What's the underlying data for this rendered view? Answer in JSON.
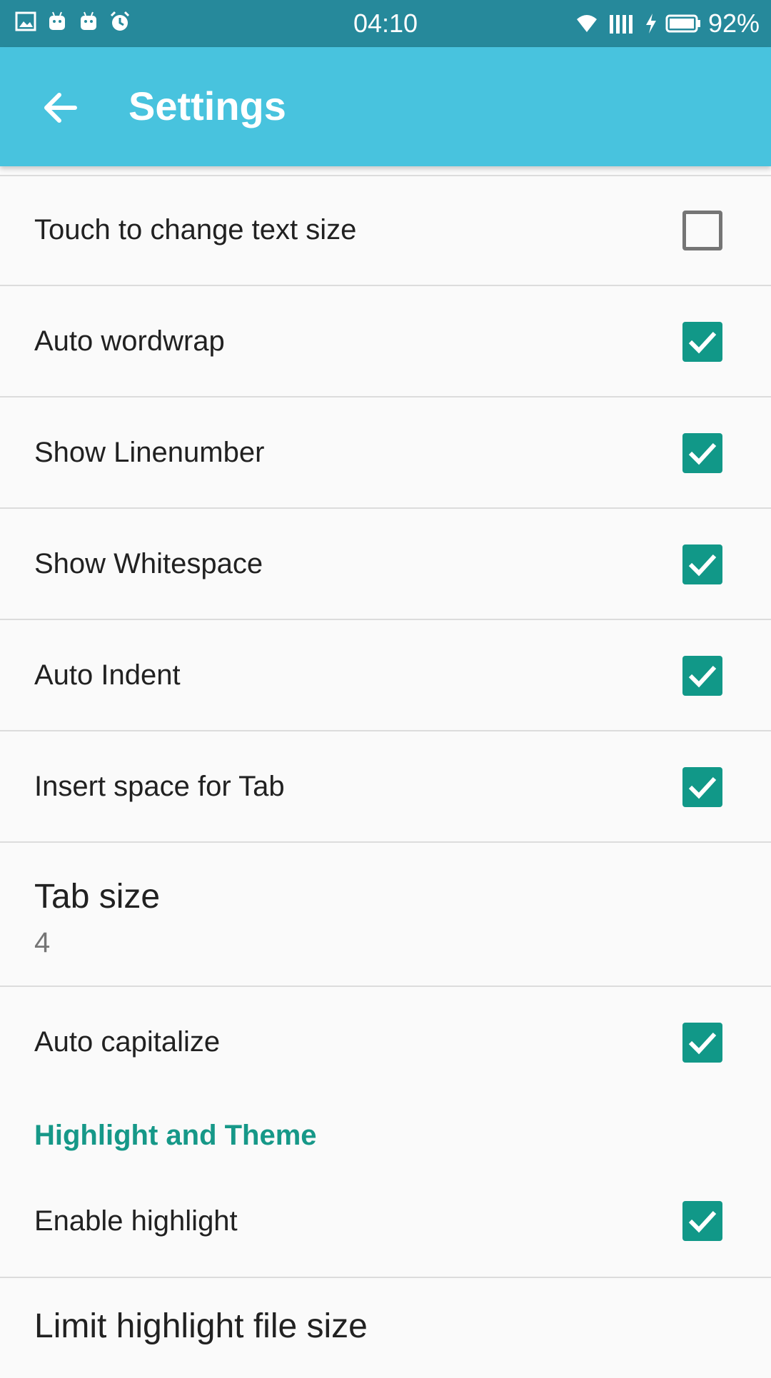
{
  "status_bar": {
    "time": "04:10",
    "battery": "92%",
    "left_icons": [
      "image-icon",
      "android-icon",
      "android-icon",
      "alarm-icon"
    ],
    "right_icons": [
      "wifi-icon",
      "signal-icon",
      "charging-icon",
      "battery-icon"
    ]
  },
  "app_bar": {
    "title": "Settings",
    "back_icon": "arrow-back-icon",
    "color": "#48c3de"
  },
  "settings": {
    "touch_text_size": {
      "label": "Touch to change text size",
      "checked": false
    },
    "auto_wordwrap": {
      "label": "Auto wordwrap",
      "checked": true
    },
    "show_linenumber": {
      "label": "Show Linenumber",
      "checked": true
    },
    "show_whitespace": {
      "label": "Show Whitespace",
      "checked": true
    },
    "auto_indent": {
      "label": "Auto Indent",
      "checked": true
    },
    "insert_space_tab": {
      "label": "Insert space for Tab",
      "checked": true
    },
    "tab_size": {
      "title": "Tab size",
      "value": "4"
    },
    "auto_capitalize": {
      "label": "Auto capitalize",
      "checked": true
    },
    "section_highlight": {
      "title": "Highlight and Theme"
    },
    "enable_highlight": {
      "label": "Enable highlight",
      "checked": true
    },
    "limit_highlight": {
      "title": "Limit highlight file size"
    }
  },
  "colors": {
    "accent": "#119888",
    "status_bar": "#26899b",
    "app_bar": "#48c3de"
  }
}
